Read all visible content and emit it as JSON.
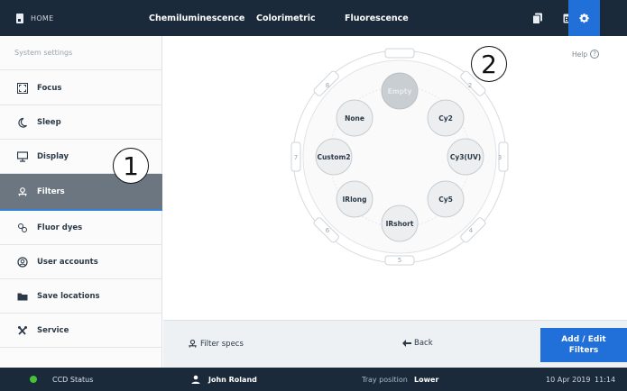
{
  "topbar": {
    "home_label": "HOME",
    "tabs": [
      "Chemiluminescence",
      "Colorimetric",
      "Fluorescence"
    ],
    "icons": [
      "copy-icon",
      "calendar-icon",
      "gear-icon"
    ],
    "accent": "#2170d9"
  },
  "sidebar": {
    "header": "System settings",
    "items": [
      {
        "label": "Focus",
        "icon": "focus-icon"
      },
      {
        "label": "Sleep",
        "icon": "moon-icon"
      },
      {
        "label": "Display",
        "icon": "monitor-icon"
      },
      {
        "label": "Filters",
        "icon": "filter-icon",
        "active": true
      },
      {
        "label": "Fluor dyes",
        "icon": "dye-icon"
      },
      {
        "label": "User accounts",
        "icon": "user-accounts-icon"
      },
      {
        "label": "Save locations",
        "icon": "folder-icon"
      },
      {
        "label": "Service",
        "icon": "tools-icon"
      }
    ]
  },
  "main": {
    "help_label": "Help",
    "callouts": [
      "1",
      "2"
    ],
    "wheel": {
      "empty_slot_label": "Empty",
      "filters": [
        "None",
        "Cy2",
        "Cy3(UV)",
        "Cy5",
        "IRshort",
        "IRlong",
        "Custom2"
      ],
      "positions": [
        "1",
        "2",
        "3",
        "4",
        "5",
        "6",
        "7",
        "8"
      ]
    }
  },
  "actions": {
    "filter_specs": "Filter specs",
    "back": "Back",
    "add_edit": "Add / Edit\nFilters"
  },
  "status": {
    "ccd_label": "CCD Status",
    "ccd_color": "#45c235",
    "user": "John Roland",
    "tray_label": "Tray position",
    "tray_value": "Lower",
    "date": "10 Apr 2019",
    "time": "11:14"
  }
}
